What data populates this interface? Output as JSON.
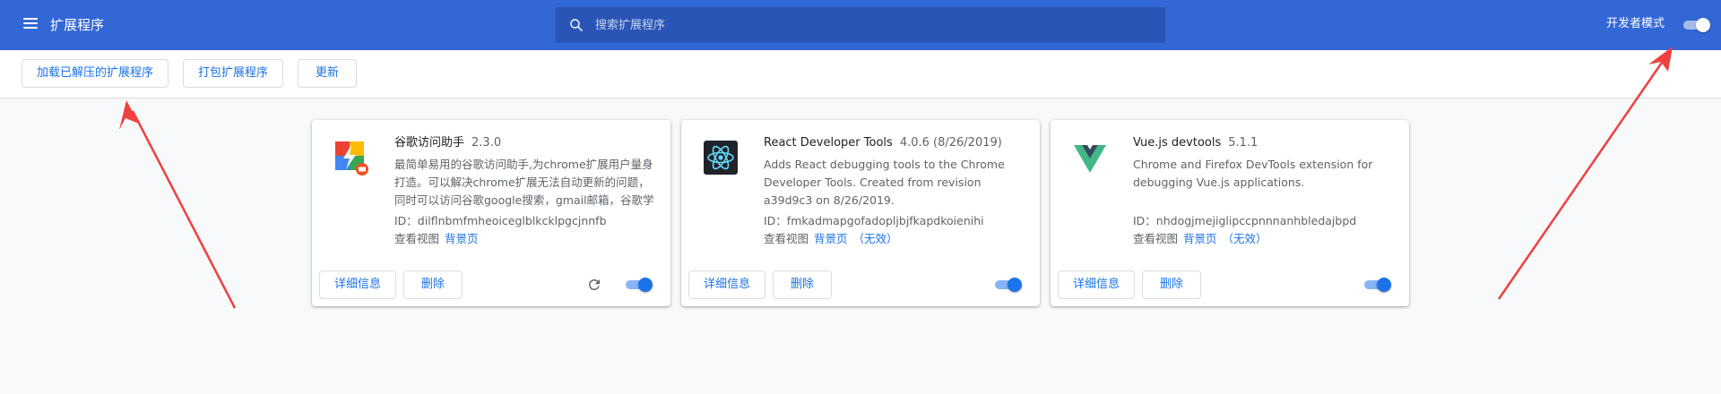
{
  "header": {
    "title": "扩展程序",
    "menu_icon": "hamburger-menu-icon",
    "search": {
      "placeholder": "搜索扩展程序",
      "icon": "search-icon"
    },
    "dev_mode": {
      "label": "开发者模式",
      "enabled": true
    }
  },
  "toolbar": {
    "load_unpacked": "加载已解压的扩展程序",
    "pack": "打包扩展程序",
    "update": "更新"
  },
  "extensions": [
    {
      "name": "谷歌访问助手",
      "version": "2.3.0",
      "description": "最简单易用的谷歌访问助手,为chrome扩展用户量身打造。可以解决chrome扩展无法自动更新的问题，同时可以访问谷歌google搜索，gmail邮箱，谷歌学术",
      "id": "ID：dilflnbmfmheoiceglblkcklpgcjnnfb",
      "views_label": "查看视图",
      "bg_link": "背景页",
      "invalid": "",
      "details_btn": "详细信息",
      "remove_btn": "删除",
      "enabled": true,
      "has_reload": true,
      "icon": "google-helper-icon"
    },
    {
      "name": "React Developer Tools",
      "version": "4.0.6 (8/26/2019)",
      "description": "Adds React debugging tools to the Chrome Developer Tools. Created from revision a39d9c3 on 8/26/2019.",
      "id": "ID：fmkadmapgofadopljbjfkapdkoienihi",
      "views_label": "查看视图",
      "bg_link": "背景页",
      "invalid": "（无效）",
      "details_btn": "详细信息",
      "remove_btn": "删除",
      "enabled": true,
      "has_reload": false,
      "icon": "react-logo-icon"
    },
    {
      "name": "Vue.js devtools",
      "version": "5.1.1",
      "description": "Chrome and Firefox DevTools extension for debugging Vue.js applications.",
      "id": "ID：nhdogjmejiglipccpnnnanhbledajbpd",
      "views_label": "查看视图",
      "bg_link": "背景页",
      "invalid": "（无效）",
      "details_btn": "详细信息",
      "remove_btn": "删除",
      "enabled": true,
      "has_reload": false,
      "icon": "vue-logo-icon"
    }
  ],
  "colors": {
    "header_bg": "#3367d6",
    "accent": "#1a73e8",
    "annotation_arrow": "#f04040"
  }
}
